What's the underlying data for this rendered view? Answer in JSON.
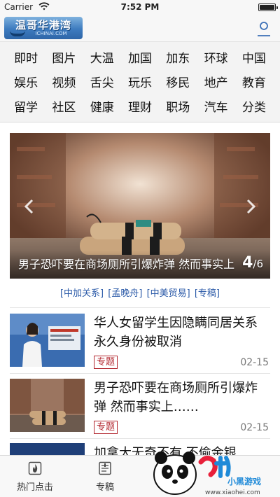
{
  "status_bar": {
    "carrier": "Carrier",
    "time": "7:52 PM"
  },
  "header": {
    "logo_title": "温哥华港湾",
    "logo_subtitle": "ICHINAI.COM"
  },
  "categories": [
    "即时",
    "图片",
    "大温",
    "加国",
    "加东",
    "环球",
    "中国",
    "娱乐",
    "视频",
    "舌尖",
    "玩乐",
    "移民",
    "地产",
    "教育",
    "留学",
    "社区",
    "健康",
    "理财",
    "职场",
    "汽车",
    "分类"
  ],
  "carousel": {
    "caption": "男子恐吓要在商场厕所引爆炸弹 然而事实上……",
    "current_page": "4",
    "total_pages": "/6"
  },
  "tags": [
    "[中加关系]",
    "[孟晚舟]",
    "[中美贸易]",
    "[专稿]"
  ],
  "news": [
    {
      "headline": "华人女留学生因隐瞒同居关系 永久身份被取消",
      "badge": "专题",
      "date": "02-15"
    },
    {
      "headline": "男子恐吓要在商场厕所引爆炸弹 然而事实上……",
      "badge": "专题",
      "date": "02-15"
    },
    {
      "headline": "加拿大无奇不有 不偷金银"
    }
  ],
  "tab_bar": [
    {
      "label": "热门点击",
      "icon": "flame-icon"
    },
    {
      "label": "专稿",
      "icon": "document-icon"
    },
    {
      "label": "",
      "icon": ""
    },
    {
      "label": "",
      "icon": ""
    }
  ],
  "watermark": {
    "brand": "小黑游戏",
    "url": "www.xiaohei.com"
  },
  "colors": {
    "accent": "#2b5aa8",
    "badge": "#b3272f",
    "header_logo": "#3d7bbf"
  }
}
